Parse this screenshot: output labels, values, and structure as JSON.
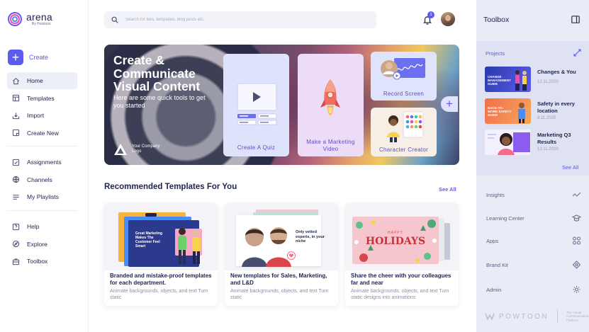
{
  "app": {
    "logo_name": "arena",
    "logo_sub": "By Powtoon"
  },
  "sidebar": {
    "create_label": "Create",
    "group1": [
      {
        "label": "Home",
        "icon": "home-icon",
        "active": true
      },
      {
        "label": "Templates",
        "icon": "templates-icon"
      },
      {
        "label": "Import",
        "icon": "import-icon"
      },
      {
        "label": "Create New",
        "icon": "create-new-icon"
      }
    ],
    "group2": [
      {
        "label": "Assignments",
        "icon": "assignments-icon"
      },
      {
        "label": "Channels",
        "icon": "globe-icon"
      },
      {
        "label": "My Playlists",
        "icon": "playlist-icon"
      }
    ],
    "group3": [
      {
        "label": "Help",
        "icon": "help-icon"
      },
      {
        "label": "Explore",
        "icon": "explore-icon"
      },
      {
        "label": "Toolbox",
        "icon": "toolbox-icon"
      }
    ]
  },
  "topbar": {
    "search_placeholder": "Search for files, templates, blog posts etc.",
    "notification_count": "1"
  },
  "hero": {
    "title": "Create & Communicate Visual Content",
    "subtitle": "Here are some quick tools to get you started",
    "logo_text": "Your Company Logo",
    "tools": {
      "quiz": "Create A Quiz",
      "marketing": "Make a Marketing Video",
      "record": "Record Screen",
      "character": "Character Creator"
    }
  },
  "recommended": {
    "title": "Recommended Templates For You",
    "see_all": "See All",
    "cards": [
      {
        "title": "Branded and mistake-proof templates for each department.",
        "desc": "Animate backgrounds, objects, and text Turn static",
        "image_text": "Great Marketing Makes The Customer Feel Smart"
      },
      {
        "title": "New templates for Sales, Marketing, and L&D",
        "desc": "Animate backgrounds, objects, and text Turn static",
        "image_text": "Only vetted experts, in your niche"
      },
      {
        "title": "Share the cheer with your colleagues far and near",
        "desc": "Animate backgrounds, objects, and text Turn static  designs into animations",
        "image_small": "HAPPY",
        "image_big": "HOLIDAYS"
      }
    ]
  },
  "toolbox": {
    "title": "Toolbox",
    "projects_label": "Projects",
    "projects": [
      {
        "name": "Changes & You",
        "date": "12.11.2020",
        "thumb_text": "CHANGE MANAGEMENT GUIDE"
      },
      {
        "name": "Safety in every location",
        "date": "8.11.2020",
        "thumb_text": "BACK-TO-WORK SAFETY GUIDE"
      },
      {
        "name": "Marketing Q3 Results",
        "date": "12.11.2020",
        "thumb_text": ""
      }
    ],
    "see_all": "See All",
    "items": [
      {
        "label": "Insights",
        "icon": "insights-icon"
      },
      {
        "label": "Learning Center",
        "icon": "learning-center-icon"
      },
      {
        "label": "Apps",
        "icon": "apps-icon"
      },
      {
        "label": "Brand Kit",
        "icon": "brand-kit-icon"
      },
      {
        "label": "Admin",
        "icon": "admin-gear-icon"
      }
    ],
    "footer_brand": "POWTOON",
    "footer_tag": "The Visual Communication Platform"
  },
  "colors": {
    "accent": "#5b5bf0",
    "text_dark": "#1f2450",
    "toolbox_bg": "#e9ebf7"
  }
}
